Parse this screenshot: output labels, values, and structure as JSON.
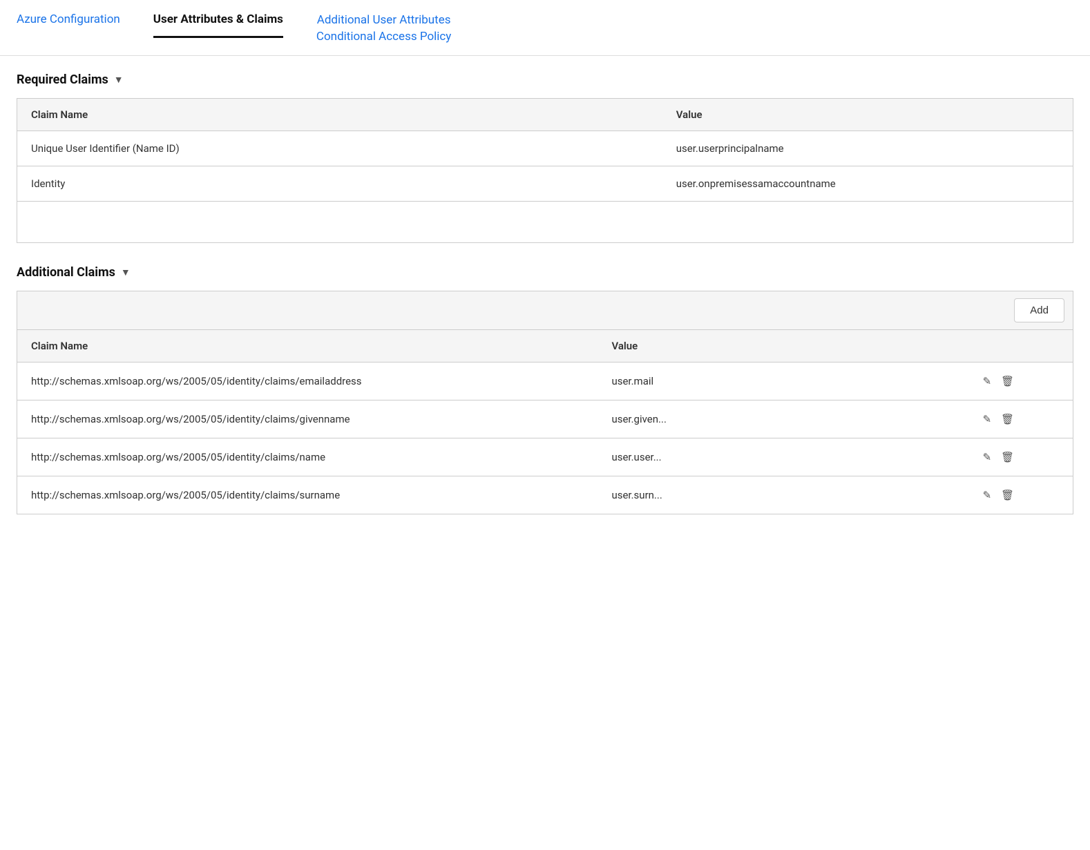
{
  "nav": {
    "tabs": [
      {
        "id": "azure-config",
        "label": "Azure Configuration",
        "active": false
      },
      {
        "id": "user-attributes-claims",
        "label": "User Attributes & Claims",
        "active": true
      },
      {
        "id": "additional-user-attributes",
        "label": "Additional User Attributes",
        "active": false
      },
      {
        "id": "conditional-access-policy",
        "label": "Conditional Access Policy",
        "active": false
      }
    ]
  },
  "sections": {
    "required_claims": {
      "heading": "Required Claims",
      "table": {
        "columns": [
          {
            "id": "claim-name",
            "label": "Claim Name"
          },
          {
            "id": "value",
            "label": "Value"
          }
        ],
        "rows": [
          {
            "claim_name": "Unique User Identifier (Name ID)",
            "value": "user.userprincipalname"
          },
          {
            "claim_name": "Identity",
            "value": "user.onpremisessamaccountname"
          }
        ]
      }
    },
    "additional_claims": {
      "heading": "Additional Claims",
      "add_button_label": "Add",
      "table": {
        "columns": [
          {
            "id": "claim-name",
            "label": "Claim Name"
          },
          {
            "id": "value",
            "label": "Value"
          },
          {
            "id": "actions",
            "label": ""
          }
        ],
        "rows": [
          {
            "claim_name": "http://schemas.xmlsoap.org/ws/2005/05/identity/claims/emailaddress",
            "value": "user.mail"
          },
          {
            "claim_name": "http://schemas.xmlsoap.org/ws/2005/05/identity/claims/givenname",
            "value": "user.given..."
          },
          {
            "claim_name": "http://schemas.xmlsoap.org/ws/2005/05/identity/claims/name",
            "value": "user.user..."
          },
          {
            "claim_name": "http://schemas.xmlsoap.org/ws/2005/05/identity/claims/surname",
            "value": "user.surn..."
          }
        ]
      }
    }
  },
  "icons": {
    "chevron_down": "▼",
    "pencil": "✎",
    "trash": "🗑"
  }
}
